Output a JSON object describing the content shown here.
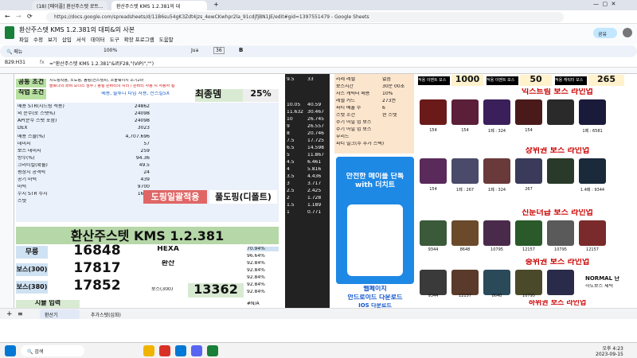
{
  "browser": {
    "tab1": "(18) [메이플] 환산주스텟 로트...",
    "tab2": "환산주스텟 KMS 1.2.381의 대",
    "url": "https://docs.google.com/spreadsheets/d/11B6su54gK3Zdt4jzs_4ewCKwhpr2la_91cdjfjBN1JE/edit#gid=1397551479 - Google Sheets"
  },
  "sheet": {
    "title": "환산주스텟 KMS 1.2.381의 대피&의 사본",
    "menus": [
      "파일",
      "수정",
      "보기",
      "삽입",
      "서식",
      "데이터",
      "도구",
      "확장 프로그램",
      "도움말"
    ],
    "share": "공유",
    "zoom": "100%",
    "font": "Jua",
    "fontsize": "36",
    "cellref": "B29:H31",
    "formula": "=\"환산주스텟 KMS 1.2.381\"&if(F28,\"(VIP)\",\"\")"
  },
  "left": {
    "r1": "공통 조건",
    "r2": "직업 조건",
    "note1": "시드링착용, 노도핑, 몸링(전스텟X), 소울웨이지 조기2마",
    "note2": "솔로나의 좌비 오더스 심수 / 용설 손바리의 시리 / 손바리 사용 시 사용하 됩",
    "conditions": "메용, 솔루니 타임 사용, 전스킬5X",
    "bestlabel": "최종뎀",
    "bestval": "25%",
    "bigtitle": "환산주스텟 KMS 1.2.381",
    "dopingA": "도핑일괄적용",
    "dopingB": "풀도핑(디폴트)"
  },
  "stats": [
    [
      "메용 STR(시드링 적용)",
      "24862"
    ],
    [
      "외 순수(로 스탯%)",
      "24098"
    ],
    [
      "AP(순수 스탯 포함)",
      "24098"
    ],
    [
      "DEX",
      "3023"
    ],
    [
      "메용 스플(%)",
      "4,707.696"
    ],
    [
      "데미지",
      "57"
    ],
    [
      "보스 데미지",
      "259"
    ],
    [
      "방무(%)",
      "94.36"
    ],
    [
      "크리티컬(확률)",
      "49.5"
    ],
    [
      "평상시 공격력",
      "24"
    ],
    [
      "공기 마력",
      "439"
    ],
    [
      "마력",
      "9700"
    ],
    [
      "무시 STR 수치",
      "1600"
    ],
    [
      "스텟",
      "16"
    ]
  ],
  "results": {
    "label1": "무릉",
    "val1": "16848",
    "label2": "보스(300)",
    "val2": "17817",
    "label3": "보스(380)",
    "val3": "17852",
    "hexa": "HEXA",
    "hexaLabel": "환산",
    "boss300": "보스(300)",
    "hexaVal": "13362",
    "simLabel": "시뮬 입력",
    "errtag": "#N/A",
    "pct1": "70.94%",
    "pct2": "96.64%",
    "pct3": "92.84%",
    "pct4": "92.84%",
    "pct5": "92.84%",
    "pct6": "92.84%",
    "pct7": "92.84%"
  },
  "mid": {
    "colJ": [
      "9.5",
      "10.05",
      "11.632",
      "10",
      "9",
      "8",
      "7.5",
      "6.5",
      "5",
      "4.5",
      "4",
      "3.5",
      "3",
      "2.5",
      "2",
      "1.5",
      "1"
    ],
    "colK": [
      "33",
      "40.59",
      "30.467",
      "26.745",
      "26.557",
      "20.746",
      "17.725",
      "14.598",
      "11.867",
      "6.461",
      "5.816",
      "4.436",
      "3.717",
      "2.425",
      "1.728",
      "1.189",
      "0.771"
    ]
  },
  "infoPanel": {
    "rows": [
      "리레 레벨",
      "보스시간",
      "차스 캐릭터 메용",
      "레벨 카드",
      "파티 배율 수",
      "스텟 조건",
      "주기 어빌 업 보스",
      "주기 어빌 업 보스",
      "부리드",
      "주기 에보",
      "파티 밀크(주 추가 스택)"
    ],
    "vals": [
      "없음",
      "30분 00초",
      "10%",
      "273권",
      "6",
      "현 스텟"
    ]
  },
  "ad": {
    "title": "안전한 메이플 단톡 with 더치트",
    "btn1": "웹페이지",
    "btn2": "안드로이드 다운로드",
    "btn3": "IOS 다운로드"
  },
  "bosses": {
    "hdr": [
      "적용 이벤트 보스",
      "1000",
      "적용 이벤트 보스",
      "50",
      "적용 캐릭터 보스",
      "265"
    ],
    "lines": [
      "익스트림 보스 라인업",
      "상위권 보스 라인업",
      "진둔더급 보스 라인업",
      "중위권 보스 라인업",
      "하위권 보스 라인업"
    ],
    "row1": [
      "154",
      "154",
      "1페 : 324",
      "154",
      "1페 : 6581"
    ],
    "row2": [
      "154",
      "1페 : 267",
      "1페 : 324",
      "267",
      "1.4페 : 9344"
    ],
    "row3": [
      "9344",
      "8648",
      "10795",
      "12157",
      "10795",
      "12157"
    ],
    "row4": [
      "9344",
      "12157",
      "8648",
      "10795"
    ],
    "normal": "NORMAL 난",
    "bottom": "하도보스 체력"
  },
  "sheettabs": [
    "환산기",
    "추가스텟(심화)"
  ],
  "taskbar": {
    "search": "검색",
    "time": "오후 4:23",
    "date": "2023-09-15"
  },
  "colors": {
    "accent": "#1a73e8",
    "green": "#188038",
    "red": "#e06666"
  }
}
